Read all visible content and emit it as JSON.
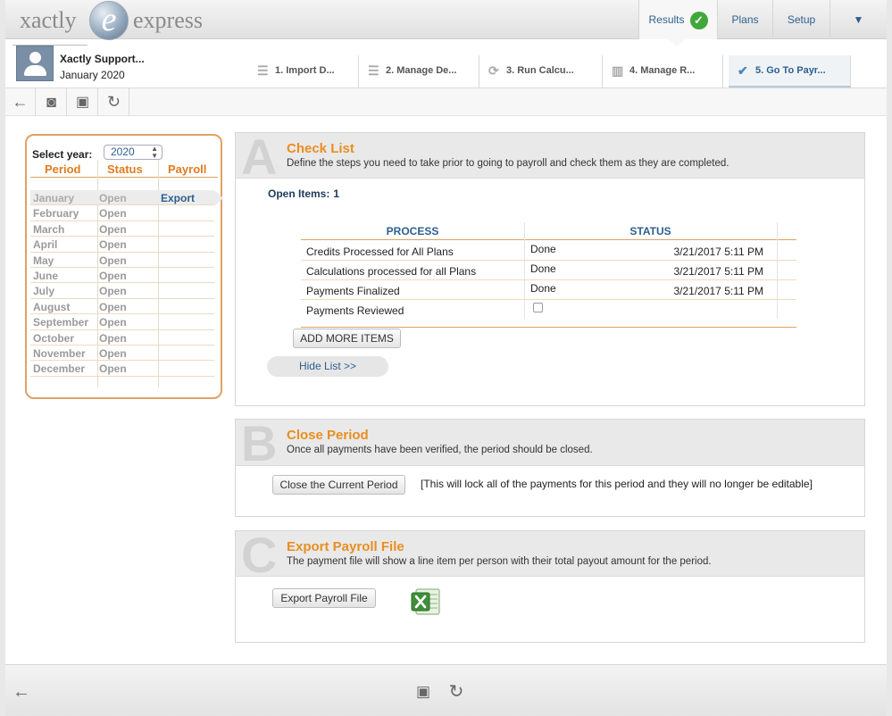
{
  "app": {
    "logo_left": "xactly",
    "logo_mark": "e",
    "logo_right": "express"
  },
  "topnav": {
    "results": "Results",
    "plans": "Plans",
    "setup": "Setup",
    "more": "▼"
  },
  "user": {
    "name": "Xactly Support...",
    "period": "January 2020"
  },
  "steps": [
    {
      "label": "1. Import D...",
      "icon": "list-icon"
    },
    {
      "label": "2. Manage De...",
      "icon": "list-icon"
    },
    {
      "label": "3. Run Calcu...",
      "icon": "refresh-icon"
    },
    {
      "label": "4. Manage R...",
      "icon": "bar-chart-icon"
    },
    {
      "label": "5. Go To Payr...",
      "icon": "checkmark-icon"
    }
  ],
  "period_panel": {
    "year_label": "Select year:",
    "year_value": "2020",
    "headers": {
      "period": "Period",
      "status": "Status",
      "payroll": "Payroll"
    },
    "rows": [
      {
        "month": "January",
        "status": "Open",
        "payroll": "Export"
      },
      {
        "month": "February",
        "status": "Open",
        "payroll": ""
      },
      {
        "month": "March",
        "status": "Open",
        "payroll": ""
      },
      {
        "month": "April",
        "status": "Open",
        "payroll": ""
      },
      {
        "month": "May",
        "status": "Open",
        "payroll": ""
      },
      {
        "month": "June",
        "status": "Open",
        "payroll": ""
      },
      {
        "month": "July",
        "status": "Open",
        "payroll": ""
      },
      {
        "month": "August",
        "status": "Open",
        "payroll": ""
      },
      {
        "month": "September",
        "status": "Open",
        "payroll": ""
      },
      {
        "month": "October",
        "status": "Open",
        "payroll": ""
      },
      {
        "month": "November",
        "status": "Open",
        "payroll": ""
      },
      {
        "month": "December",
        "status": "Open",
        "payroll": ""
      }
    ]
  },
  "section_a": {
    "letter": "A",
    "title": "Check List",
    "subtitle": "Define the steps you need to take prior to going to payroll and check them as they are completed.",
    "open_items_label": "Open Items:",
    "open_items_count": "1",
    "col_process": "PROCESS",
    "col_status": "STATUS",
    "rows": [
      {
        "process": "Credits Processed for All Plans",
        "status": "Done",
        "date": "3/21/2017 5:11 PM"
      },
      {
        "process": "Calculations processed for all Plans",
        "status": "Done",
        "date": "3/21/2017 5:11 PM"
      },
      {
        "process": "Payments Finalized",
        "status": "Done",
        "date": "3/21/2017 5:11 PM"
      },
      {
        "process": "Payments Reviewed",
        "status": "",
        "date": ""
      }
    ],
    "add_more": "ADD MORE ITEMS",
    "hide_list": "Hide List >>"
  },
  "section_b": {
    "letter": "B",
    "title": "Close Period",
    "subtitle": "Once all payments have been verified, the period should be closed.",
    "button": "Close the Current Period",
    "note": "[This will lock all of the payments for this period and they will no longer be editable]"
  },
  "section_c": {
    "letter": "C",
    "title": "Export Payroll File",
    "subtitle": "The payment file will show a line item per person with their total payout amount for the period.",
    "button": "Export Payroll File"
  },
  "colors": {
    "accent_orange": "#e98e1f",
    "link_blue": "#2d5f8f",
    "success_green": "#3fa839"
  }
}
